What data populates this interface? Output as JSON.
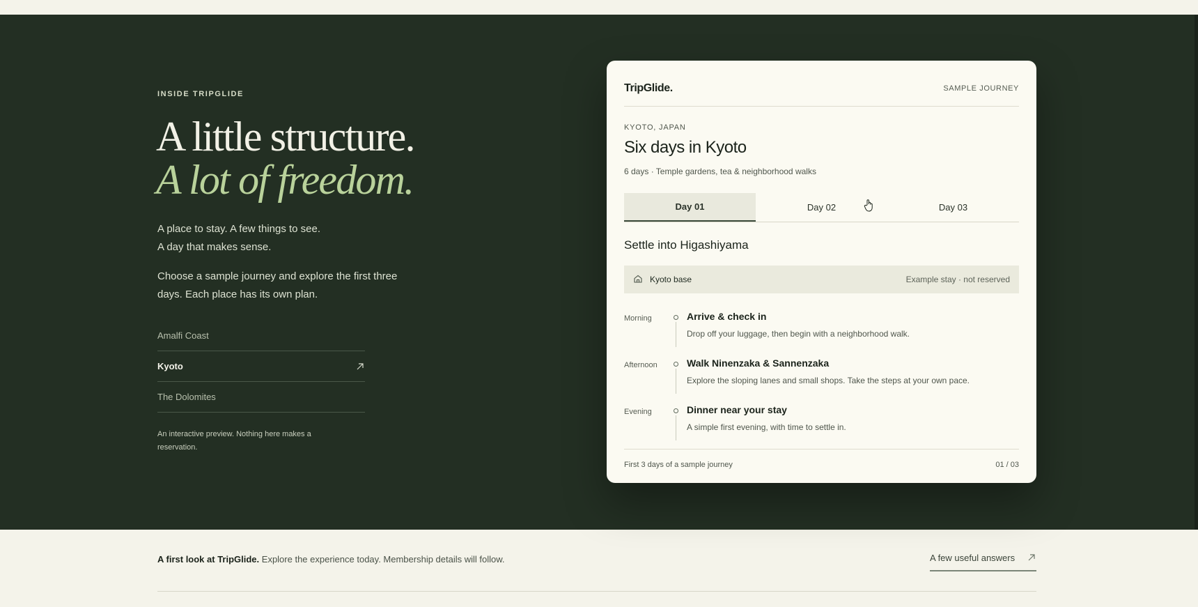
{
  "hero": {
    "eyebrow": "INSIDE TRIPGLIDE",
    "headline": "A little structure.",
    "headline_italic": "A lot of freedom.",
    "intro_line1": "A place to stay. A few things to see.",
    "intro_line2": "A day that makes sense.",
    "intro_body": "Choose a sample journey and explore the first three days. Each place has its own plan.",
    "destinations": [
      {
        "label": "Amalfi Coast",
        "active": false
      },
      {
        "label": "Kyoto",
        "active": true
      },
      {
        "label": "The Dolomites",
        "active": false
      }
    ],
    "note": "An interactive preview. Nothing here makes a reservation."
  },
  "card": {
    "brand": "TripGlide.",
    "tag": "SAMPLE JOURNEY",
    "location": "KYOTO, JAPAN",
    "title": "Six days in Kyoto",
    "meta": "6 days · Temple gardens, tea & neighborhood walks",
    "tabs": [
      "Day 01",
      "Day 02",
      "Day 03"
    ],
    "active_tab": 0,
    "day_heading": "Settle into Higashiyama",
    "stay": {
      "label": "Kyoto base",
      "status": "Example stay · not reserved",
      "icon": "home-icon"
    },
    "schedule": [
      {
        "time": "Morning",
        "title": "Arrive & check in",
        "desc": "Drop off your luggage, then begin with a neighborhood walk."
      },
      {
        "time": "Afternoon",
        "title": "Walk Ninenzaka & Sannenzaka",
        "desc": "Explore the sloping lanes and small shops. Take the steps at your own pace."
      },
      {
        "time": "Evening",
        "title": "Dinner near your stay",
        "desc": "A simple first evening, with time to settle in."
      }
    ],
    "footer_left": "First 3 days of a sample journey",
    "footer_right": "01 / 03"
  },
  "bottom": {
    "lead": "A first look at TripGlide.",
    "text": " Explore the experience today. Membership details will follow.",
    "link": "A few useful answers"
  },
  "colors": {
    "dark_bg": "#232f23",
    "light_bg": "#f4f3ea",
    "accent_green": "#b9d29b",
    "card_bg": "#fbfaf2"
  }
}
